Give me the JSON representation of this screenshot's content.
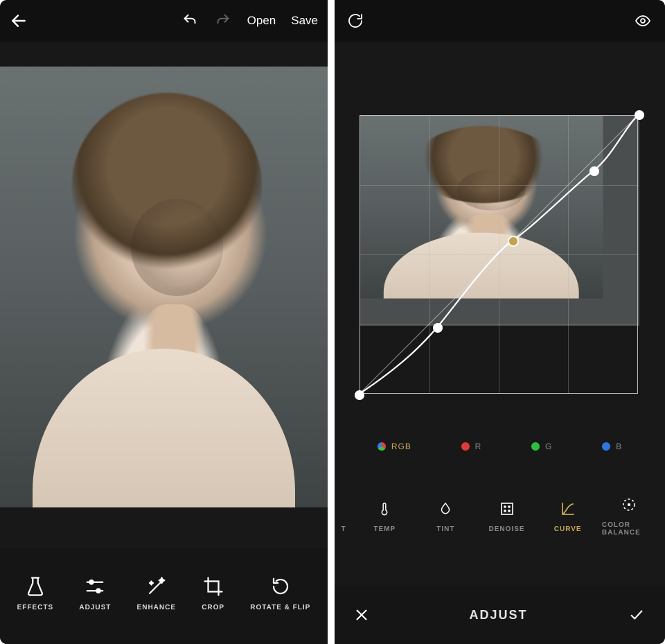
{
  "left": {
    "header": {
      "open_label": "Open",
      "save_label": "Save"
    },
    "tools": [
      {
        "key": "effects",
        "label": "EFFECTS"
      },
      {
        "key": "adjust",
        "label": "ADJUST"
      },
      {
        "key": "enhance",
        "label": "ENHANCE"
      },
      {
        "key": "crop",
        "label": "CROP"
      },
      {
        "key": "rotate",
        "label": "ROTATE & FLIP"
      }
    ]
  },
  "right": {
    "channels": [
      {
        "key": "rgb",
        "label": "RGB",
        "active": true
      },
      {
        "key": "r",
        "label": "R",
        "active": false
      },
      {
        "key": "g",
        "label": "G",
        "active": false
      },
      {
        "key": "b",
        "label": "B",
        "active": false
      }
    ],
    "adjust_tools": [
      {
        "key": "hint",
        "label": "T",
        "active": false,
        "partial": true
      },
      {
        "key": "temp",
        "label": "TEMP",
        "active": false
      },
      {
        "key": "tint",
        "label": "TINT",
        "active": false
      },
      {
        "key": "denoise",
        "label": "DENOISE",
        "active": false
      },
      {
        "key": "curve",
        "label": "CURVE",
        "active": true
      },
      {
        "key": "colorbalance",
        "label": "COLOR BALANCE",
        "active": false
      }
    ],
    "footer_title": "ADJUST",
    "curve": {
      "grid_divisions": 4,
      "points": [
        {
          "x": 0.0,
          "y": 0.0
        },
        {
          "x": 0.28,
          "y": 0.24
        },
        {
          "x": 0.55,
          "y": 0.55,
          "selected": true
        },
        {
          "x": 0.84,
          "y": 0.8
        },
        {
          "x": 1.0,
          "y": 1.0
        }
      ]
    }
  }
}
